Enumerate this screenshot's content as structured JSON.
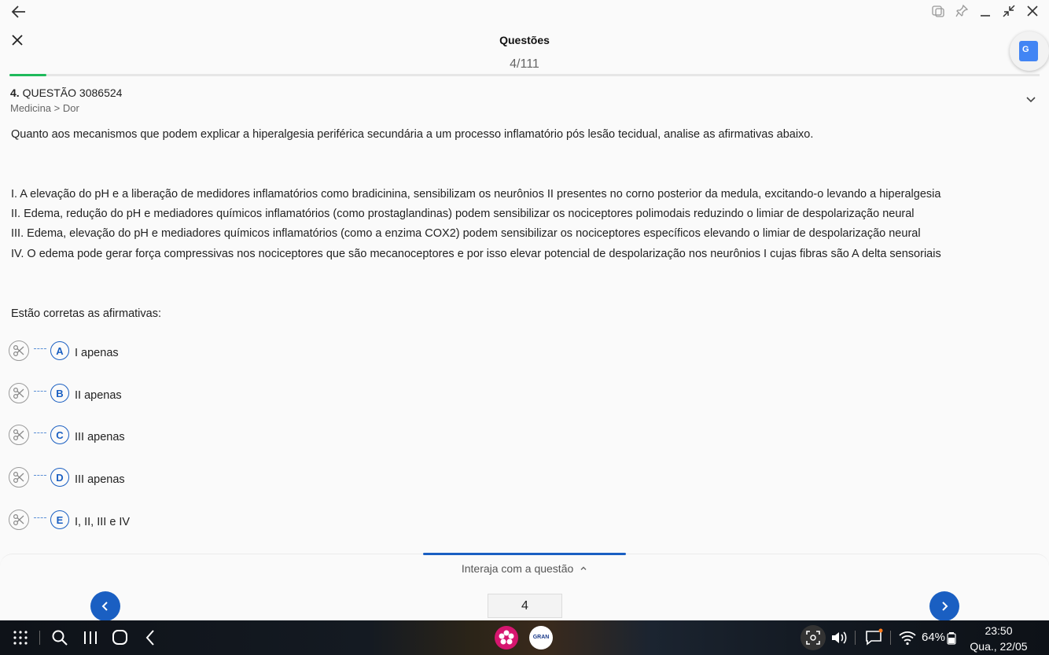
{
  "header": {
    "title": "Questões",
    "counter": "4/111"
  },
  "translate": {
    "label": "G"
  },
  "progress": {
    "fraction": 0.036
  },
  "question": {
    "number": "4.",
    "label": "QUESTÃO 3086524",
    "category": "Medicina > Dor",
    "prompt": "Quanto aos mecanismos que podem explicar a hiperalgesia periférica secundária a um processo inflamatório pós lesão tecidual, analise as afirmativas abaixo.",
    "statements": [
      "I. A elevação do pH e a liberação de medidores inflamatórios como bradicinina, sensibilizam os neurônios II presentes no corno posterior da medula, excitando-o levando a hiperalgesia",
      "II. Edema, redução do pH e mediadores químicos inflamatórios (como prostaglandinas) podem sensibilizar os nociceptores polimodais reduzindo o limiar de despolarização neural",
      "III. Edema, elevação do pH e mediadores químicos inflamatórios (como a enzima COX2) podem sensibilizar os nociceptores específicos elevando o limiar de despolarização neural",
      "IV. O edema pode gerar força compressivas nos nociceptores que são mecanoceptores e por isso elevar potencial de despolarização nos neurônios I cujas fibras são A delta sensoriais"
    ],
    "ask": "Estão corretas as afirmativas:",
    "alternatives": [
      {
        "letter": "A",
        "text": "I apenas"
      },
      {
        "letter": "B",
        "text": "II apenas"
      },
      {
        "letter": "C",
        "text": "III apenas"
      },
      {
        "letter": "D",
        "text": "III apenas"
      },
      {
        "letter": "E",
        "text": "I, II, III e IV"
      }
    ]
  },
  "bottom": {
    "interact_label": "Interaja com a questão",
    "page_value": "4"
  },
  "taskbar": {
    "battery": "64%",
    "time": "23:50",
    "date": "Qua., 22/05",
    "gran_label": "GRAN"
  },
  "colors": {
    "accent": "#1a5fc2",
    "progress": "#1fba5b"
  }
}
